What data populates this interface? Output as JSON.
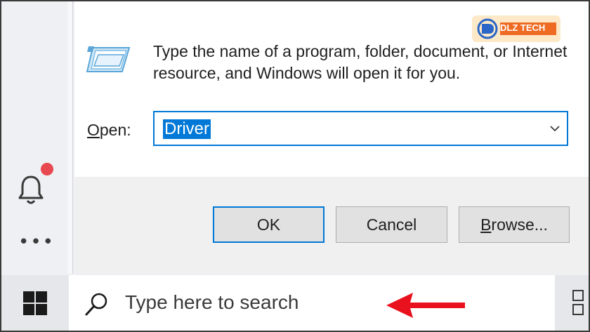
{
  "logo": {
    "text": "DLZ TECH"
  },
  "dialog": {
    "description": "Type the name of a program, folder, document, or Internet resource, and Windows will open it for you.",
    "open_label_prefix": "O",
    "open_label_rest": "pen:",
    "open_value": "Driver",
    "buttons": {
      "ok": "OK",
      "cancel": "Cancel",
      "browse_prefix": "B",
      "browse_rest": "rowse..."
    }
  },
  "taskbar": {
    "search_placeholder": "Type here to search"
  },
  "colors": {
    "accent": "#0078d7",
    "notification": "#e8484f",
    "arrow": "#e8111d"
  }
}
